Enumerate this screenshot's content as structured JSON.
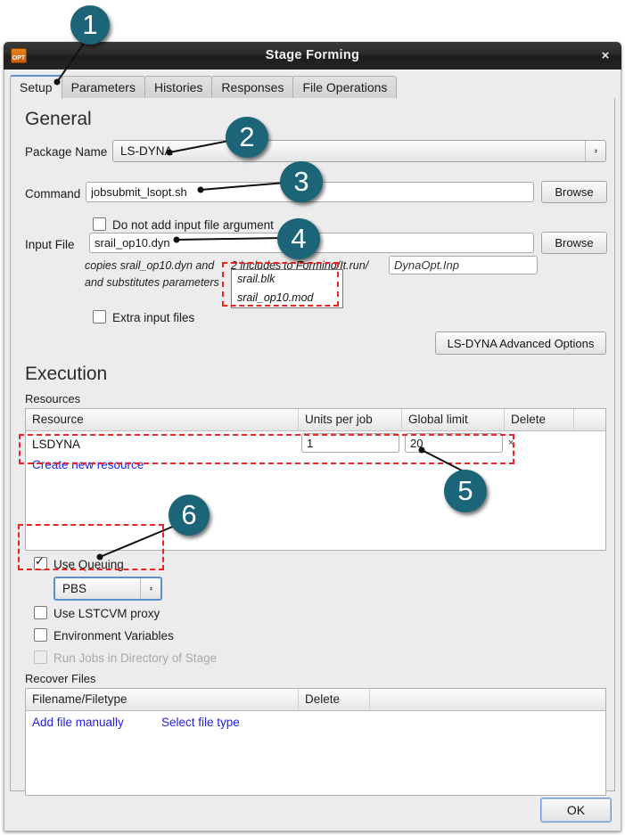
{
  "window": {
    "title": "Stage Forming",
    "app_icon": "opt-logo-icon",
    "close_label": "×"
  },
  "tabs": [
    {
      "label": "Setup",
      "active": true
    },
    {
      "label": "Parameters",
      "active": false
    },
    {
      "label": "Histories",
      "active": false
    },
    {
      "label": "Responses",
      "active": false
    },
    {
      "label": "File Operations",
      "active": false
    }
  ],
  "general": {
    "heading": "General",
    "package_label": "Package Name",
    "package_value": "LS-DYNA",
    "command_label": "Command",
    "command_value": "jobsubmit_lsopt.sh",
    "command_browse": "Browse",
    "no_input_arg_label": "Do not add input file argument",
    "no_input_arg_checked": false,
    "input_file_label": "Input File",
    "input_file_value": "srail_op10.dyn",
    "input_browse": "Browse",
    "note_line1_pre": "copies srail_op10.dyn and",
    "note_link": "2 includes",
    "note_line1_post": "to Forming/It.run/",
    "note_line2": "and substitutes parameters",
    "output_name_value": "DynaOpt.Inp",
    "includes_popup": [
      "srail.blk",
      "srail_op10.mod"
    ],
    "extra_input_files_label": "Extra input files",
    "extra_input_files_checked": false,
    "advanced_options": "LS-DYNA Advanced Options"
  },
  "execution": {
    "heading": "Execution",
    "resources_label": "Resources",
    "resources_columns": [
      "Resource",
      "Units per job",
      "Global limit",
      "Delete"
    ],
    "resources_rows": [
      {
        "resource": "LSDYNA",
        "units_per_job": "1",
        "global_limit": "20",
        "delete": "×"
      }
    ],
    "create_new_resource": "Create new resource",
    "use_queuing_label": "Use Queuing",
    "use_queuing_checked": true,
    "queue_value": "PBS",
    "lstcvm_label": "Use LSTCVM proxy",
    "lstcvm_checked": false,
    "env_vars_label": "Environment Variables",
    "env_vars_checked": false,
    "run_jobs_label": "Run Jobs in Directory of Stage",
    "run_jobs_checked": false,
    "run_jobs_disabled": true
  },
  "recover": {
    "heading": "Recover Files",
    "columns": [
      "Filename/Filetype",
      "Delete"
    ],
    "add_file_manually": "Add file manually",
    "select_file_type": "Select file type"
  },
  "footer": {
    "ok_label": "OK"
  },
  "annotations": {
    "badges": [
      "1",
      "2",
      "3",
      "4",
      "5",
      "6"
    ],
    "badge_color": "#1c6578",
    "highlight_color": "#ef2222"
  }
}
